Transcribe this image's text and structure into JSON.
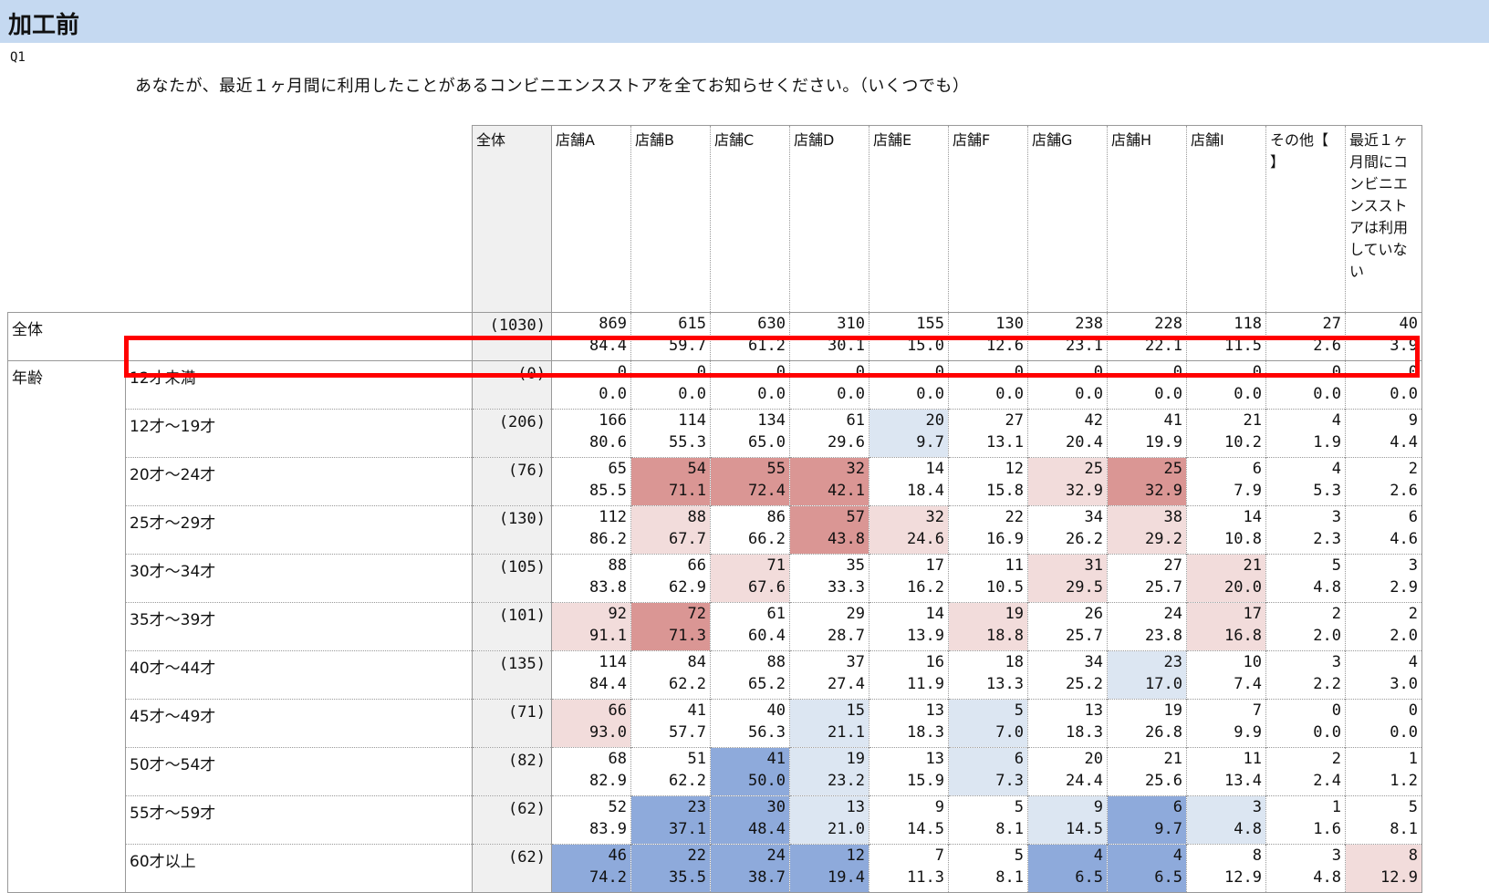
{
  "title": "加工前",
  "question_no": "Q1",
  "question_text": "あなたが、最近１ヶ月間に利用したことがあるコンビニエンスストアを全てお知らせください。（いくつでも）",
  "header": {
    "total": "全体",
    "columns": [
      "店舗A",
      "店舗B",
      "店舗C",
      "店舗D",
      "店舗E",
      "店舗F",
      "店舗G",
      "店舗H",
      "店舗I",
      "その他【\n】",
      "最近１ヶ月間にコンビニエンスストアは利用していない"
    ]
  },
  "colors": {
    "red_strong": "#da9694",
    "red_light": "#f2dcdb",
    "blue_strong": "#8eaadb",
    "blue_light": "#dce6f2"
  },
  "rows": [
    {
      "group": "全体",
      "label": "",
      "base": "(1030)",
      "n": [
        "869",
        "615",
        "630",
        "310",
        "155",
        "130",
        "238",
        "228",
        "118",
        "27",
        "40"
      ],
      "p": [
        "84.4",
        "59.7",
        "61.2",
        "30.1",
        "15.0",
        "12.6",
        "23.1",
        "22.1",
        "11.5",
        "2.6",
        "3.9"
      ],
      "hl": [
        "",
        "",
        "",
        "",
        "",
        "",
        "",
        "",
        "",
        "",
        ""
      ]
    },
    {
      "group": "年齢",
      "label": "12才未満",
      "base": "(0)",
      "n": [
        "0",
        "0",
        "0",
        "0",
        "0",
        "0",
        "0",
        "0",
        "0",
        "0",
        "0"
      ],
      "p": [
        "0.0",
        "0.0",
        "0.0",
        "0.0",
        "0.0",
        "0.0",
        "0.0",
        "0.0",
        "0.0",
        "0.0",
        "0.0"
      ],
      "hl": [
        "",
        "",
        "",
        "",
        "",
        "",
        "",
        "",
        "",
        "",
        ""
      ]
    },
    {
      "group": "",
      "label": "12才～19才",
      "base": "(206)",
      "n": [
        "166",
        "114",
        "134",
        "61",
        "20",
        "27",
        "42",
        "41",
        "21",
        "4",
        "9"
      ],
      "p": [
        "80.6",
        "55.3",
        "65.0",
        "29.6",
        "9.7",
        "13.1",
        "20.4",
        "19.9",
        "10.2",
        "1.9",
        "4.4"
      ],
      "hl": [
        "",
        "",
        "",
        "",
        "bl",
        "",
        "",
        "",
        "",
        "",
        ""
      ]
    },
    {
      "group": "",
      "label": "20才～24才",
      "base": "(76)",
      "n": [
        "65",
        "54",
        "55",
        "32",
        "14",
        "12",
        "25",
        "25",
        "6",
        "4",
        "2"
      ],
      "p": [
        "85.5",
        "71.1",
        "72.4",
        "42.1",
        "18.4",
        "15.8",
        "32.9",
        "32.9",
        "7.9",
        "5.3",
        "2.6"
      ],
      "hl": [
        "",
        "rs",
        "rs",
        "rs",
        "",
        "",
        "rl",
        "rs",
        "",
        "",
        ""
      ]
    },
    {
      "group": "",
      "label": "25才～29才",
      "base": "(130)",
      "n": [
        "112",
        "88",
        "86",
        "57",
        "32",
        "22",
        "34",
        "38",
        "14",
        "3",
        "6"
      ],
      "p": [
        "86.2",
        "67.7",
        "66.2",
        "43.8",
        "24.6",
        "16.9",
        "26.2",
        "29.2",
        "10.8",
        "2.3",
        "4.6"
      ],
      "hl": [
        "",
        "rl",
        "",
        "rs",
        "rl",
        "",
        "",
        "rl",
        "",
        "",
        ""
      ]
    },
    {
      "group": "",
      "label": "30才～34才",
      "base": "(105)",
      "n": [
        "88",
        "66",
        "71",
        "35",
        "17",
        "11",
        "31",
        "27",
        "21",
        "5",
        "3"
      ],
      "p": [
        "83.8",
        "62.9",
        "67.6",
        "33.3",
        "16.2",
        "10.5",
        "29.5",
        "25.7",
        "20.0",
        "4.8",
        "2.9"
      ],
      "hl": [
        "",
        "",
        "rl",
        "",
        "",
        "",
        "rl",
        "",
        "rl",
        "",
        ""
      ]
    },
    {
      "group": "",
      "label": "35才～39才",
      "base": "(101)",
      "n": [
        "92",
        "72",
        "61",
        "29",
        "14",
        "19",
        "26",
        "24",
        "17",
        "2",
        "2"
      ],
      "p": [
        "91.1",
        "71.3",
        "60.4",
        "28.7",
        "13.9",
        "18.8",
        "25.7",
        "23.8",
        "16.8",
        "2.0",
        "2.0"
      ],
      "hl": [
        "rl",
        "rs",
        "",
        "",
        "",
        "rl",
        "",
        "",
        "rl",
        "",
        ""
      ]
    },
    {
      "group": "",
      "label": "40才～44才",
      "base": "(135)",
      "n": [
        "114",
        "84",
        "88",
        "37",
        "16",
        "18",
        "34",
        "23",
        "10",
        "3",
        "4"
      ],
      "p": [
        "84.4",
        "62.2",
        "65.2",
        "27.4",
        "11.9",
        "13.3",
        "25.2",
        "17.0",
        "7.4",
        "2.2",
        "3.0"
      ],
      "hl": [
        "",
        "",
        "",
        "",
        "",
        "",
        "",
        "bl",
        "",
        "",
        ""
      ]
    },
    {
      "group": "",
      "label": "45才～49才",
      "base": "(71)",
      "n": [
        "66",
        "41",
        "40",
        "15",
        "13",
        "5",
        "13",
        "19",
        "7",
        "0",
        "0"
      ],
      "p": [
        "93.0",
        "57.7",
        "56.3",
        "21.1",
        "18.3",
        "7.0",
        "18.3",
        "26.8",
        "9.9",
        "0.0",
        "0.0"
      ],
      "hl": [
        "rl",
        "",
        "",
        "bl",
        "",
        "bl",
        "",
        "",
        "",
        "",
        ""
      ]
    },
    {
      "group": "",
      "label": "50才～54才",
      "base": "(82)",
      "n": [
        "68",
        "51",
        "41",
        "19",
        "13",
        "6",
        "20",
        "21",
        "11",
        "2",
        "1"
      ],
      "p": [
        "82.9",
        "62.2",
        "50.0",
        "23.2",
        "15.9",
        "7.3",
        "24.4",
        "25.6",
        "13.4",
        "2.4",
        "1.2"
      ],
      "hl": [
        "",
        "",
        "bs",
        "bl",
        "",
        "bl",
        "",
        "",
        "",
        "",
        ""
      ]
    },
    {
      "group": "",
      "label": "55才～59才",
      "base": "(62)",
      "n": [
        "52",
        "23",
        "30",
        "13",
        "9",
        "5",
        "9",
        "6",
        "3",
        "1",
        "5"
      ],
      "p": [
        "83.9",
        "37.1",
        "48.4",
        "21.0",
        "14.5",
        "8.1",
        "14.5",
        "9.7",
        "4.8",
        "1.6",
        "8.1"
      ],
      "hl": [
        "",
        "bs",
        "bs",
        "bl",
        "",
        "",
        "bl",
        "bs",
        "bl",
        "",
        ""
      ]
    },
    {
      "group": "",
      "label": "60才以上",
      "base": "(62)",
      "n": [
        "46",
        "22",
        "24",
        "12",
        "7",
        "5",
        "4",
        "4",
        "8",
        "3",
        "8"
      ],
      "p": [
        "74.2",
        "35.5",
        "38.7",
        "19.4",
        "11.3",
        "8.1",
        "6.5",
        "6.5",
        "12.9",
        "4.8",
        "12.9"
      ],
      "hl": [
        "bs",
        "bs",
        "bs",
        "bs",
        "",
        "",
        "bs",
        "bs",
        "",
        "",
        "rl"
      ]
    }
  ]
}
